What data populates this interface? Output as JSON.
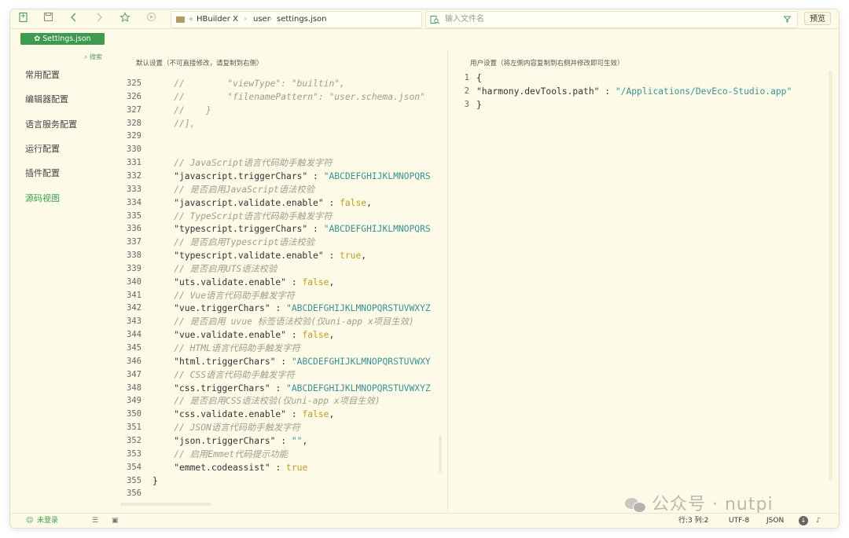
{
  "toolbar": {
    "breadcrumb": [
      "HBuilder X",
      "user",
      "settings.json"
    ],
    "breadcrumb_sep": "«",
    "search_placeholder": "输入文件名",
    "preview_label": "预览"
  },
  "tab": {
    "label": "Settings.json"
  },
  "sidebar": {
    "search_label": "搜索",
    "items": [
      {
        "label": "常用配置",
        "active": false
      },
      {
        "label": "编辑器配置",
        "active": false
      },
      {
        "label": "语言服务配置",
        "active": false
      },
      {
        "label": "运行配置",
        "active": false
      },
      {
        "label": "插件配置",
        "active": false
      },
      {
        "label": "源码视图",
        "active": true
      }
    ]
  },
  "left_pane": {
    "title": "默认设置（不可直接修改，请复制到右侧）",
    "lines": [
      {
        "n": "325",
        "parts": [
          {
            "t": "    //        \"viewType\": \"builtin\",",
            "c": "comment"
          }
        ]
      },
      {
        "n": "326",
        "parts": [
          {
            "t": "    //        \"filenamePattern\": \"user.schema.json\"",
            "c": "comment"
          }
        ]
      },
      {
        "n": "327",
        "parts": [
          {
            "t": "    //    }",
            "c": "comment"
          }
        ]
      },
      {
        "n": "328",
        "parts": [
          {
            "t": "    //],",
            "c": "comment"
          }
        ]
      },
      {
        "n": "329",
        "parts": []
      },
      {
        "n": "330",
        "parts": []
      },
      {
        "n": "331",
        "parts": [
          {
            "t": "    // JavaScript语言代码助手触发字符",
            "c": "comment"
          }
        ]
      },
      {
        "n": "332",
        "parts": [
          {
            "t": "    \"javascript.triggerChars\"",
            "c": "key"
          },
          {
            "t": " : ",
            "c": "punct"
          },
          {
            "t": "\"ABCDEFGHIJKLMNOPQRS",
            "c": "str"
          }
        ]
      },
      {
        "n": "333",
        "parts": [
          {
            "t": "    // 是否启用JavaScript语法校验",
            "c": "comment"
          }
        ]
      },
      {
        "n": "334",
        "parts": [
          {
            "t": "    \"javascript.validate.enable\"",
            "c": "key"
          },
          {
            "t": " : ",
            "c": "punct"
          },
          {
            "t": "false",
            "c": "kw"
          },
          {
            "t": ",",
            "c": "punct"
          }
        ]
      },
      {
        "n": "335",
        "parts": [
          {
            "t": "    // TypeScript语言代码助手触发字符",
            "c": "comment"
          }
        ]
      },
      {
        "n": "336",
        "parts": [
          {
            "t": "    \"typescript.triggerChars\"",
            "c": "key"
          },
          {
            "t": " : ",
            "c": "punct"
          },
          {
            "t": "\"ABCDEFGHIJKLMNOPQRS",
            "c": "str"
          }
        ]
      },
      {
        "n": "337",
        "parts": [
          {
            "t": "    // 是否启用Typescript语法校验",
            "c": "comment"
          }
        ]
      },
      {
        "n": "338",
        "parts": [
          {
            "t": "    \"typescript.validate.enable\"",
            "c": "key"
          },
          {
            "t": " : ",
            "c": "punct"
          },
          {
            "t": "true",
            "c": "kw"
          },
          {
            "t": ",",
            "c": "punct"
          }
        ]
      },
      {
        "n": "339",
        "parts": [
          {
            "t": "    // 是否启用UTS语法校验",
            "c": "comment"
          }
        ]
      },
      {
        "n": "340",
        "parts": [
          {
            "t": "    \"uts.validate.enable\"",
            "c": "key"
          },
          {
            "t": " : ",
            "c": "punct"
          },
          {
            "t": "false",
            "c": "kw"
          },
          {
            "t": ",",
            "c": "punct"
          }
        ]
      },
      {
        "n": "341",
        "parts": [
          {
            "t": "    // Vue语言代码助手触发字符",
            "c": "comment"
          }
        ]
      },
      {
        "n": "342",
        "parts": [
          {
            "t": "    \"vue.triggerChars\"",
            "c": "key"
          },
          {
            "t": " : ",
            "c": "punct"
          },
          {
            "t": "\"ABCDEFGHIJKLMNOPQRSTUVWXYZ",
            "c": "str"
          }
        ]
      },
      {
        "n": "343",
        "parts": [
          {
            "t": "    // 是否启用 uvue 标签语法校验(仅uni-app x项目生效)",
            "c": "comment"
          }
        ]
      },
      {
        "n": "344",
        "parts": [
          {
            "t": "    \"vue.validate.enable\"",
            "c": "key"
          },
          {
            "t": " : ",
            "c": "punct"
          },
          {
            "t": "false",
            "c": "kw"
          },
          {
            "t": ",",
            "c": "punct"
          }
        ]
      },
      {
        "n": "345",
        "parts": [
          {
            "t": "    // HTML语言代码助手触发字符",
            "c": "comment"
          }
        ]
      },
      {
        "n": "346",
        "parts": [
          {
            "t": "    \"html.triggerChars\"",
            "c": "key"
          },
          {
            "t": " : ",
            "c": "punct"
          },
          {
            "t": "\"ABCDEFGHIJKLMNOPQRSTUVWXY",
            "c": "str"
          }
        ]
      },
      {
        "n": "347",
        "parts": [
          {
            "t": "    // CSS语言代码助手触发字符",
            "c": "comment"
          }
        ]
      },
      {
        "n": "348",
        "parts": [
          {
            "t": "    \"css.triggerChars\"",
            "c": "key"
          },
          {
            "t": " : ",
            "c": "punct"
          },
          {
            "t": "\"ABCDEFGHIJKLMNOPQRSTUVWXYZ",
            "c": "str"
          }
        ]
      },
      {
        "n": "349",
        "parts": [
          {
            "t": "    // 是否启用CSS语法校验(仅uni-app x项目生效)",
            "c": "comment"
          }
        ]
      },
      {
        "n": "350",
        "parts": [
          {
            "t": "    \"css.validate.enable\"",
            "c": "key"
          },
          {
            "t": " : ",
            "c": "punct"
          },
          {
            "t": "false",
            "c": "kw"
          },
          {
            "t": ",",
            "c": "punct"
          }
        ]
      },
      {
        "n": "351",
        "parts": [
          {
            "t": "    // JSON语言代码助手触发字符",
            "c": "comment"
          }
        ]
      },
      {
        "n": "352",
        "parts": [
          {
            "t": "    \"json.triggerChars\"",
            "c": "key"
          },
          {
            "t": " : ",
            "c": "punct"
          },
          {
            "t": "\"\"",
            "c": "str"
          },
          {
            "t": ",",
            "c": "punct"
          }
        ]
      },
      {
        "n": "353",
        "parts": [
          {
            "t": "    // 启用Emmet代码提示功能",
            "c": "comment"
          }
        ]
      },
      {
        "n": "354",
        "parts": [
          {
            "t": "    \"emmet.codeassist\"",
            "c": "key"
          },
          {
            "t": " : ",
            "c": "punct"
          },
          {
            "t": "true",
            "c": "kw"
          }
        ]
      },
      {
        "n": "355",
        "parts": [
          {
            "t": "}",
            "c": "punct"
          }
        ]
      },
      {
        "n": "356",
        "parts": []
      }
    ]
  },
  "right_pane": {
    "title": "用户设置（将左侧内容复制到右侧并修改即可生效）",
    "lines": [
      {
        "n": "1",
        "parts": [
          {
            "t": "{",
            "c": "punct"
          }
        ]
      },
      {
        "n": "2",
        "parts": [
          {
            "t": "\"harmony.devTools.path\"",
            "c": "key"
          },
          {
            "t": " : ",
            "c": "punct"
          },
          {
            "t": "\"/Applications/DevEco-Studio.app\"",
            "c": "str"
          }
        ]
      },
      {
        "n": "3",
        "parts": [
          {
            "t": "}",
            "c": "punct"
          }
        ]
      }
    ]
  },
  "watermark": {
    "text": "公众号 · nutpi"
  },
  "statusbar": {
    "login": "未登录",
    "position": "行:3  列:2",
    "encoding": "UTF-8",
    "language": "JSON"
  },
  "colors": {
    "accent": "#3e9a4e",
    "background": "#fdfbe8",
    "string": "#3c8f96",
    "keyword": "#c49a1a",
    "comment": "#9aa08c"
  }
}
